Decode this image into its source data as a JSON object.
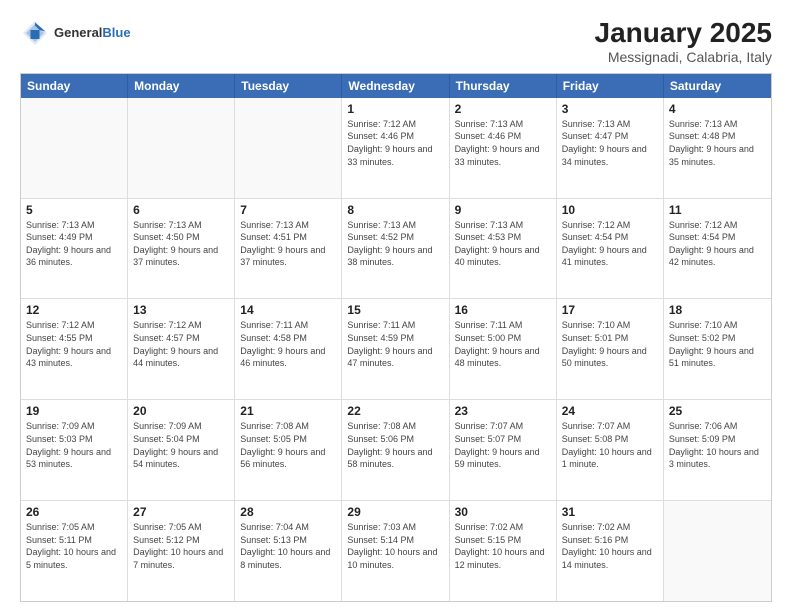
{
  "header": {
    "logo_general": "General",
    "logo_blue": "Blue",
    "month_title": "January 2025",
    "location": "Messignadi, Calabria, Italy"
  },
  "weekdays": [
    "Sunday",
    "Monday",
    "Tuesday",
    "Wednesday",
    "Thursday",
    "Friday",
    "Saturday"
  ],
  "weeks": [
    [
      {
        "day": "",
        "detail": "",
        "empty": true
      },
      {
        "day": "",
        "detail": "",
        "empty": true
      },
      {
        "day": "",
        "detail": "",
        "empty": true
      },
      {
        "day": "1",
        "detail": "Sunrise: 7:12 AM\nSunset: 4:46 PM\nDaylight: 9 hours and 33 minutes.",
        "empty": false
      },
      {
        "day": "2",
        "detail": "Sunrise: 7:13 AM\nSunset: 4:46 PM\nDaylight: 9 hours and 33 minutes.",
        "empty": false
      },
      {
        "day": "3",
        "detail": "Sunrise: 7:13 AM\nSunset: 4:47 PM\nDaylight: 9 hours and 34 minutes.",
        "empty": false
      },
      {
        "day": "4",
        "detail": "Sunrise: 7:13 AM\nSunset: 4:48 PM\nDaylight: 9 hours and 35 minutes.",
        "empty": false
      }
    ],
    [
      {
        "day": "5",
        "detail": "Sunrise: 7:13 AM\nSunset: 4:49 PM\nDaylight: 9 hours and 36 minutes.",
        "empty": false
      },
      {
        "day": "6",
        "detail": "Sunrise: 7:13 AM\nSunset: 4:50 PM\nDaylight: 9 hours and 37 minutes.",
        "empty": false
      },
      {
        "day": "7",
        "detail": "Sunrise: 7:13 AM\nSunset: 4:51 PM\nDaylight: 9 hours and 37 minutes.",
        "empty": false
      },
      {
        "day": "8",
        "detail": "Sunrise: 7:13 AM\nSunset: 4:52 PM\nDaylight: 9 hours and 38 minutes.",
        "empty": false
      },
      {
        "day": "9",
        "detail": "Sunrise: 7:13 AM\nSunset: 4:53 PM\nDaylight: 9 hours and 40 minutes.",
        "empty": false
      },
      {
        "day": "10",
        "detail": "Sunrise: 7:12 AM\nSunset: 4:54 PM\nDaylight: 9 hours and 41 minutes.",
        "empty": false
      },
      {
        "day": "11",
        "detail": "Sunrise: 7:12 AM\nSunset: 4:54 PM\nDaylight: 9 hours and 42 minutes.",
        "empty": false
      }
    ],
    [
      {
        "day": "12",
        "detail": "Sunrise: 7:12 AM\nSunset: 4:55 PM\nDaylight: 9 hours and 43 minutes.",
        "empty": false
      },
      {
        "day": "13",
        "detail": "Sunrise: 7:12 AM\nSunset: 4:57 PM\nDaylight: 9 hours and 44 minutes.",
        "empty": false
      },
      {
        "day": "14",
        "detail": "Sunrise: 7:11 AM\nSunset: 4:58 PM\nDaylight: 9 hours and 46 minutes.",
        "empty": false
      },
      {
        "day": "15",
        "detail": "Sunrise: 7:11 AM\nSunset: 4:59 PM\nDaylight: 9 hours and 47 minutes.",
        "empty": false
      },
      {
        "day": "16",
        "detail": "Sunrise: 7:11 AM\nSunset: 5:00 PM\nDaylight: 9 hours and 48 minutes.",
        "empty": false
      },
      {
        "day": "17",
        "detail": "Sunrise: 7:10 AM\nSunset: 5:01 PM\nDaylight: 9 hours and 50 minutes.",
        "empty": false
      },
      {
        "day": "18",
        "detail": "Sunrise: 7:10 AM\nSunset: 5:02 PM\nDaylight: 9 hours and 51 minutes.",
        "empty": false
      }
    ],
    [
      {
        "day": "19",
        "detail": "Sunrise: 7:09 AM\nSunset: 5:03 PM\nDaylight: 9 hours and 53 minutes.",
        "empty": false
      },
      {
        "day": "20",
        "detail": "Sunrise: 7:09 AM\nSunset: 5:04 PM\nDaylight: 9 hours and 54 minutes.",
        "empty": false
      },
      {
        "day": "21",
        "detail": "Sunrise: 7:08 AM\nSunset: 5:05 PM\nDaylight: 9 hours and 56 minutes.",
        "empty": false
      },
      {
        "day": "22",
        "detail": "Sunrise: 7:08 AM\nSunset: 5:06 PM\nDaylight: 9 hours and 58 minutes.",
        "empty": false
      },
      {
        "day": "23",
        "detail": "Sunrise: 7:07 AM\nSunset: 5:07 PM\nDaylight: 9 hours and 59 minutes.",
        "empty": false
      },
      {
        "day": "24",
        "detail": "Sunrise: 7:07 AM\nSunset: 5:08 PM\nDaylight: 10 hours and 1 minute.",
        "empty": false
      },
      {
        "day": "25",
        "detail": "Sunrise: 7:06 AM\nSunset: 5:09 PM\nDaylight: 10 hours and 3 minutes.",
        "empty": false
      }
    ],
    [
      {
        "day": "26",
        "detail": "Sunrise: 7:05 AM\nSunset: 5:11 PM\nDaylight: 10 hours and 5 minutes.",
        "empty": false
      },
      {
        "day": "27",
        "detail": "Sunrise: 7:05 AM\nSunset: 5:12 PM\nDaylight: 10 hours and 7 minutes.",
        "empty": false
      },
      {
        "day": "28",
        "detail": "Sunrise: 7:04 AM\nSunset: 5:13 PM\nDaylight: 10 hours and 8 minutes.",
        "empty": false
      },
      {
        "day": "29",
        "detail": "Sunrise: 7:03 AM\nSunset: 5:14 PM\nDaylight: 10 hours and 10 minutes.",
        "empty": false
      },
      {
        "day": "30",
        "detail": "Sunrise: 7:02 AM\nSunset: 5:15 PM\nDaylight: 10 hours and 12 minutes.",
        "empty": false
      },
      {
        "day": "31",
        "detail": "Sunrise: 7:02 AM\nSunset: 5:16 PM\nDaylight: 10 hours and 14 minutes.",
        "empty": false
      },
      {
        "day": "",
        "detail": "",
        "empty": true
      }
    ]
  ]
}
